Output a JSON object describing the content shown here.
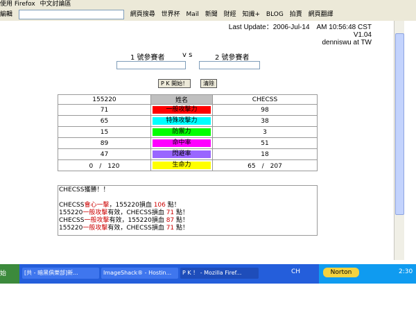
{
  "browser": {
    "top_links": [
      "使用 Firefox",
      "中文討論區"
    ],
    "edit_label": "編輯",
    "toolbar_items": [
      "網頁搜尋",
      "世界杯",
      "Mail",
      "新聞",
      "財經",
      "知識+",
      "BLOG",
      "拍賣",
      "網頁翻譯"
    ]
  },
  "page": {
    "update_text": "Last Update：2006-Jul-14　AM 10:56:48 CST",
    "version": "V1.04",
    "author": "denniswu at TW",
    "player1_label": "1 號參賽者",
    "vs_label": "v s",
    "player2_label": "2 號參賽者",
    "pk_button": "P K 開始！",
    "clear_button": "清除",
    "table": {
      "left_name": "155220",
      "header": "姓名",
      "right_name": "CHECSS",
      "rows": [
        {
          "left": "71",
          "label": "一般攻擊力",
          "right": "98",
          "color": "#ff0000"
        },
        {
          "left": "65",
          "label": "特殊攻擊力",
          "right": "38",
          "color": "#00ffff"
        },
        {
          "left": "15",
          "label": "防禦力",
          "right": "3",
          "color": "#00ff00"
        },
        {
          "left": "89",
          "label": "命中率",
          "right": "51",
          "color": "#ff00ff"
        },
        {
          "left": "47",
          "label": "閃避率",
          "right": "18",
          "color": "#9966ff"
        },
        {
          "left": "0　/　120",
          "label": "生命力",
          "right": "65　/　207",
          "color": "#ffff00"
        }
      ]
    },
    "log": {
      "winner": "CHECSS獲勝！！",
      "l1a": "CHECSS",
      "l1b": "會心一擊",
      "l1c": "，155220損血 ",
      "l1d": "106",
      "l1e": " 點！",
      "l2a": "155220",
      "l2b": "一般攻擊",
      "l2c": "有效，CHECSS損血 ",
      "l2d": "71",
      "l2e": " 點！",
      "l3a": "CHECSS",
      "l3b": "一般攻擊",
      "l3c": "有效，155220損血 ",
      "l3d": "87",
      "l3e": " 點！",
      "l4a": "155220",
      "l4b": "一般攻擊",
      "l4c": "有效，CHECSS損血 ",
      "l4d": "71",
      "l4e": " 點！"
    }
  },
  "taskbar": {
    "start_label": "始",
    "tasks": [
      "[共 - 暗黑俱樂部]新...",
      "ImageShack® - Hostin...",
      "P K ！ - Mozilla Firef..."
    ],
    "ime": "CH",
    "norton": "Norton",
    "clock": "2:30"
  }
}
